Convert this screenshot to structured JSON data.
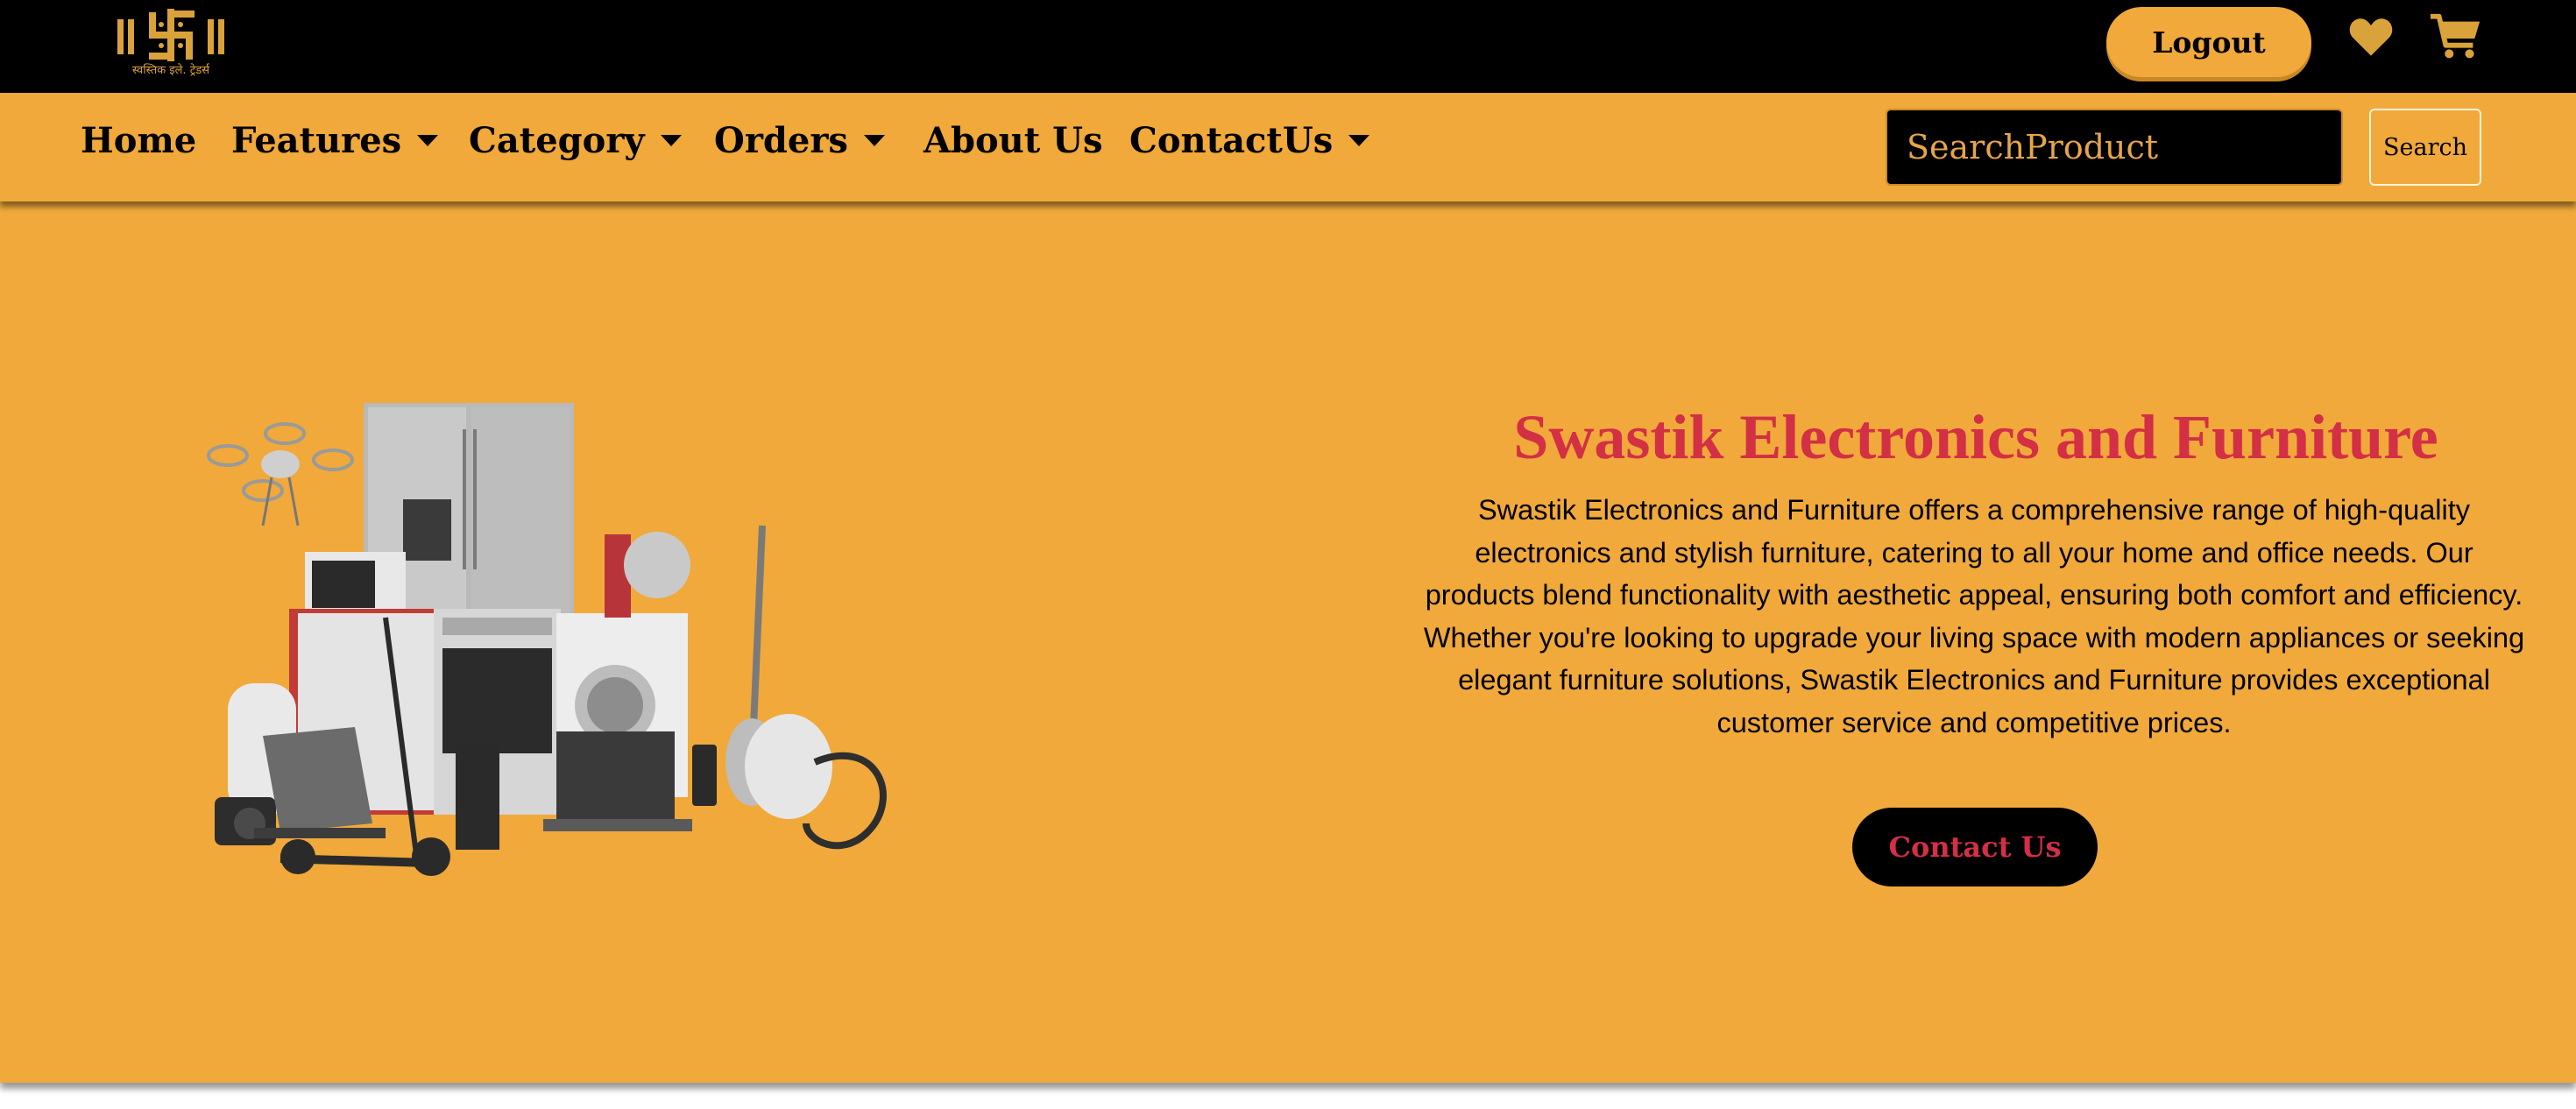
{
  "brand": {
    "logo_text": "स्वस्तिक इले. ट्रेडर्स"
  },
  "header": {
    "logout_label": "Logout",
    "wishlist_icon": "heart-icon",
    "cart_icon": "cart-icon"
  },
  "nav": {
    "items": [
      {
        "label": "Home",
        "has_dropdown": false
      },
      {
        "label": "Features",
        "has_dropdown": true
      },
      {
        "label": "Category",
        "has_dropdown": true
      },
      {
        "label": "Orders",
        "has_dropdown": true
      },
      {
        "label": "About Us",
        "has_dropdown": false
      },
      {
        "label": "ContactUs",
        "has_dropdown": true
      }
    ],
    "search_placeholder": "SearchProduct",
    "search_button": "Search"
  },
  "hero": {
    "title": "Swastik Electronics and Furniture",
    "description": "Swastik Electronics and Furniture offers a comprehensive range of high-quality electronics and stylish furniture, catering to all your home and office needs. Our products blend functionality with aesthetic appeal, ensuring both comfort and efficiency. Whether you're looking to upgrade your living space with modern appliances or seeking elegant furniture solutions, Swastik Electronics and Furniture provides exceptional customer service and competitive prices.",
    "cta_label": "Contact Us"
  },
  "colors": {
    "accent": "#f0a93a",
    "header_bg": "#000000",
    "title_red": "#d32f45"
  }
}
